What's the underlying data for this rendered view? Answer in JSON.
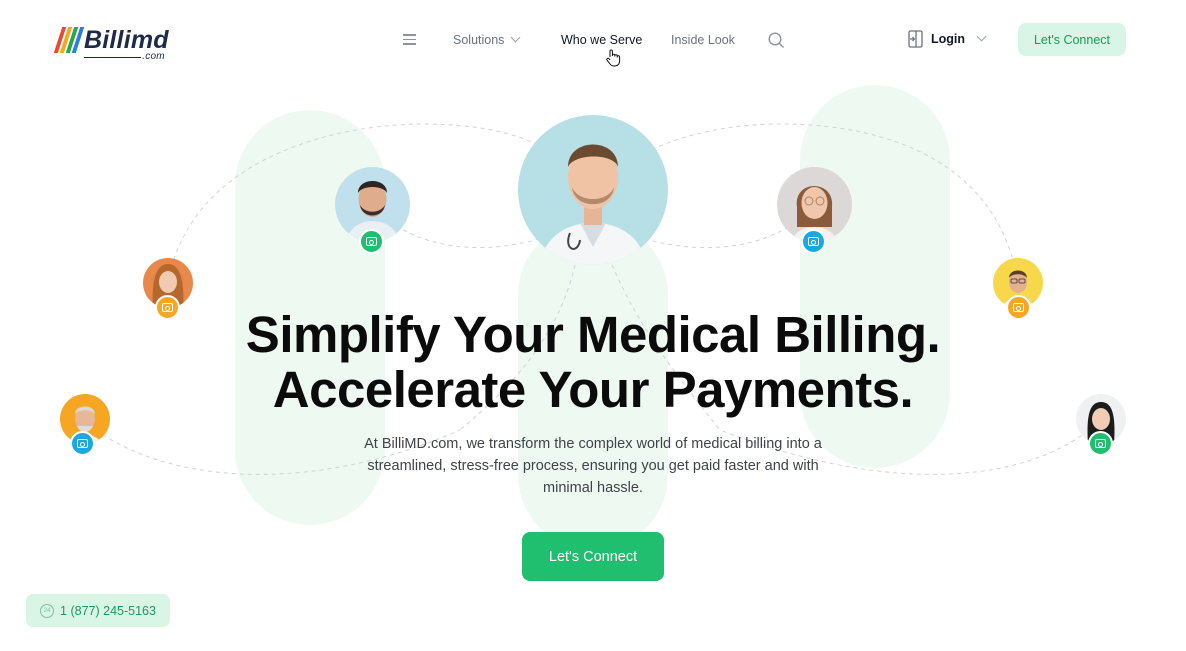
{
  "brand": {
    "name": "Billimd",
    "suffix": ".com",
    "bar_colors": [
      "#e94a35",
      "#f5a623",
      "#29a745",
      "#2a7fd9"
    ],
    "accent": "#1fbf6f",
    "accent_light": "#d9f5e6"
  },
  "nav": {
    "menu_icon": "hamburger-icon",
    "solutions": "Solutions",
    "who_we_serve": "Who we Serve",
    "inside_look": "Inside Look",
    "search_icon": "search-icon",
    "login": "Login",
    "lets_connect": "Let's Connect"
  },
  "hero": {
    "headline_line1": "Simplify Your Medical Billing.",
    "headline_line2": "Accelerate Your Payments.",
    "subtext": "At BilliMD.com, we transform the complex world of medical billing into a streamlined, stress-free process, ensuring you get paid faster and with minimal hassle.",
    "cta": "Let's Connect"
  },
  "avatars": [
    {
      "name": "doctor-main",
      "badge_color": null
    },
    {
      "name": "man-bearded",
      "badge_color": "#1fbf6f"
    },
    {
      "name": "woman-glasses",
      "badge_color": "#1aa8e0"
    },
    {
      "name": "woman-redhair",
      "badge_color": "#f5a623"
    },
    {
      "name": "man-yellow-bg",
      "badge_color": "#f5a623"
    },
    {
      "name": "older-man",
      "badge_color": "#1aa8e0"
    },
    {
      "name": "woman-asian",
      "badge_color": "#1fbf6f"
    }
  ],
  "contact": {
    "phone": "1 (877) 245-5163",
    "icon": "24-hour-phone-icon"
  }
}
